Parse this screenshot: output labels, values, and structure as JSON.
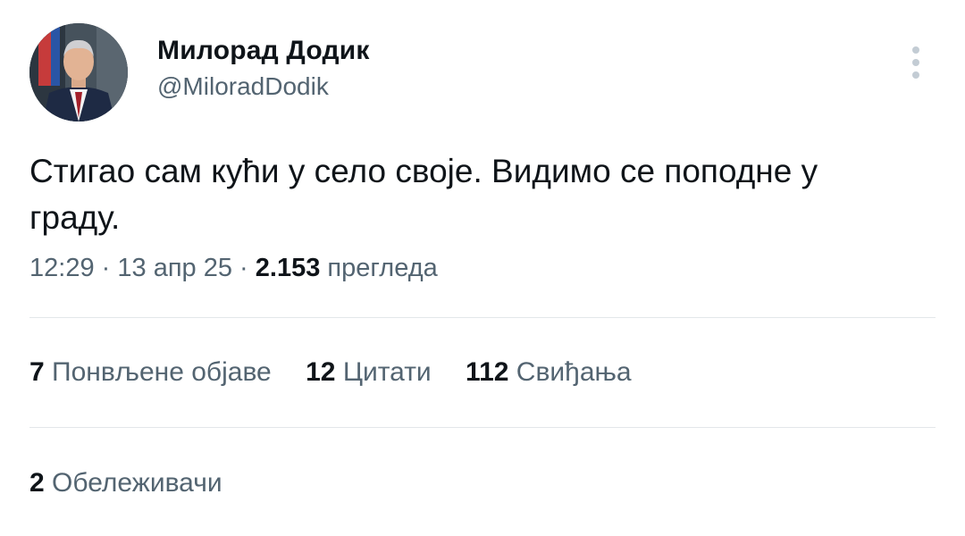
{
  "author": {
    "display_name": "Милорад Додик",
    "handle": "@MiloradDodik",
    "avatar_icon": "profile-photo"
  },
  "more_icon": "vertical-ellipsis-icon",
  "tweet": {
    "text": "Стигао сам кући у село своје. Видимо се поподне у граду.",
    "time": "12:29",
    "date": "13 апр 25",
    "views_count": "2.153",
    "views_label": "прегледа",
    "separator": "·"
  },
  "stats": {
    "reposts": {
      "count": "7",
      "label": "Понвљене објаве"
    },
    "quotes": {
      "count": "12",
      "label": "Цитати"
    },
    "likes": {
      "count": "112",
      "label": "Свиђања"
    },
    "bookmarks": {
      "count": "2",
      "label": "Обележивачи"
    }
  },
  "colors": {
    "text": "#0f1419",
    "secondary": "#536471",
    "divider": "#e3e7ea"
  }
}
